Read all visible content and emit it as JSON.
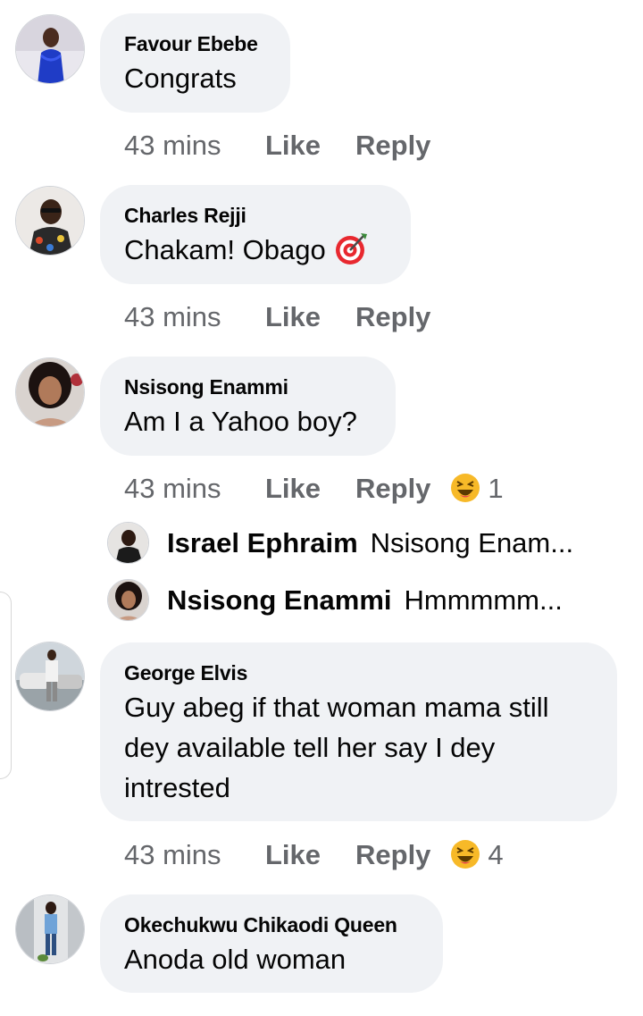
{
  "comments": [
    {
      "author": "Favour Ebebe",
      "text": "Congrats",
      "time": "43 mins",
      "like": "Like",
      "reply": "Reply"
    },
    {
      "author": "Charles Rejji",
      "text": "Chakam! Obago",
      "emoji": "direct-hit-emoji",
      "time": "43 mins",
      "like": "Like",
      "reply": "Reply"
    },
    {
      "author": "Nsisong Enammi",
      "text": "Am I a Yahoo boy?",
      "time": "43 mins",
      "like": "Like",
      "reply": "Reply",
      "reaction": "laughing-emoji",
      "reaction_count": "1",
      "replies": [
        {
          "author": "Israel Ephraim",
          "text": "Nsisong Enam..."
        },
        {
          "author": "Nsisong Enammi",
          "text": "Hmmmmm..."
        }
      ]
    },
    {
      "author": "George Elvis",
      "text_lines": [
        "Guy abeg if that woman mama still",
        "dey available tell her say I dey",
        "intrested"
      ],
      "time": "43 mins",
      "like": "Like",
      "reply": "Reply",
      "reaction": "laughing-emoji",
      "reaction_count": "4"
    },
    {
      "author": "Okechukwu Chikaodi Queen",
      "text": "Anoda old woman"
    }
  ],
  "colors": {
    "bubble": "#f0f2f5",
    "meta": "#65676b",
    "text": "#050505"
  }
}
